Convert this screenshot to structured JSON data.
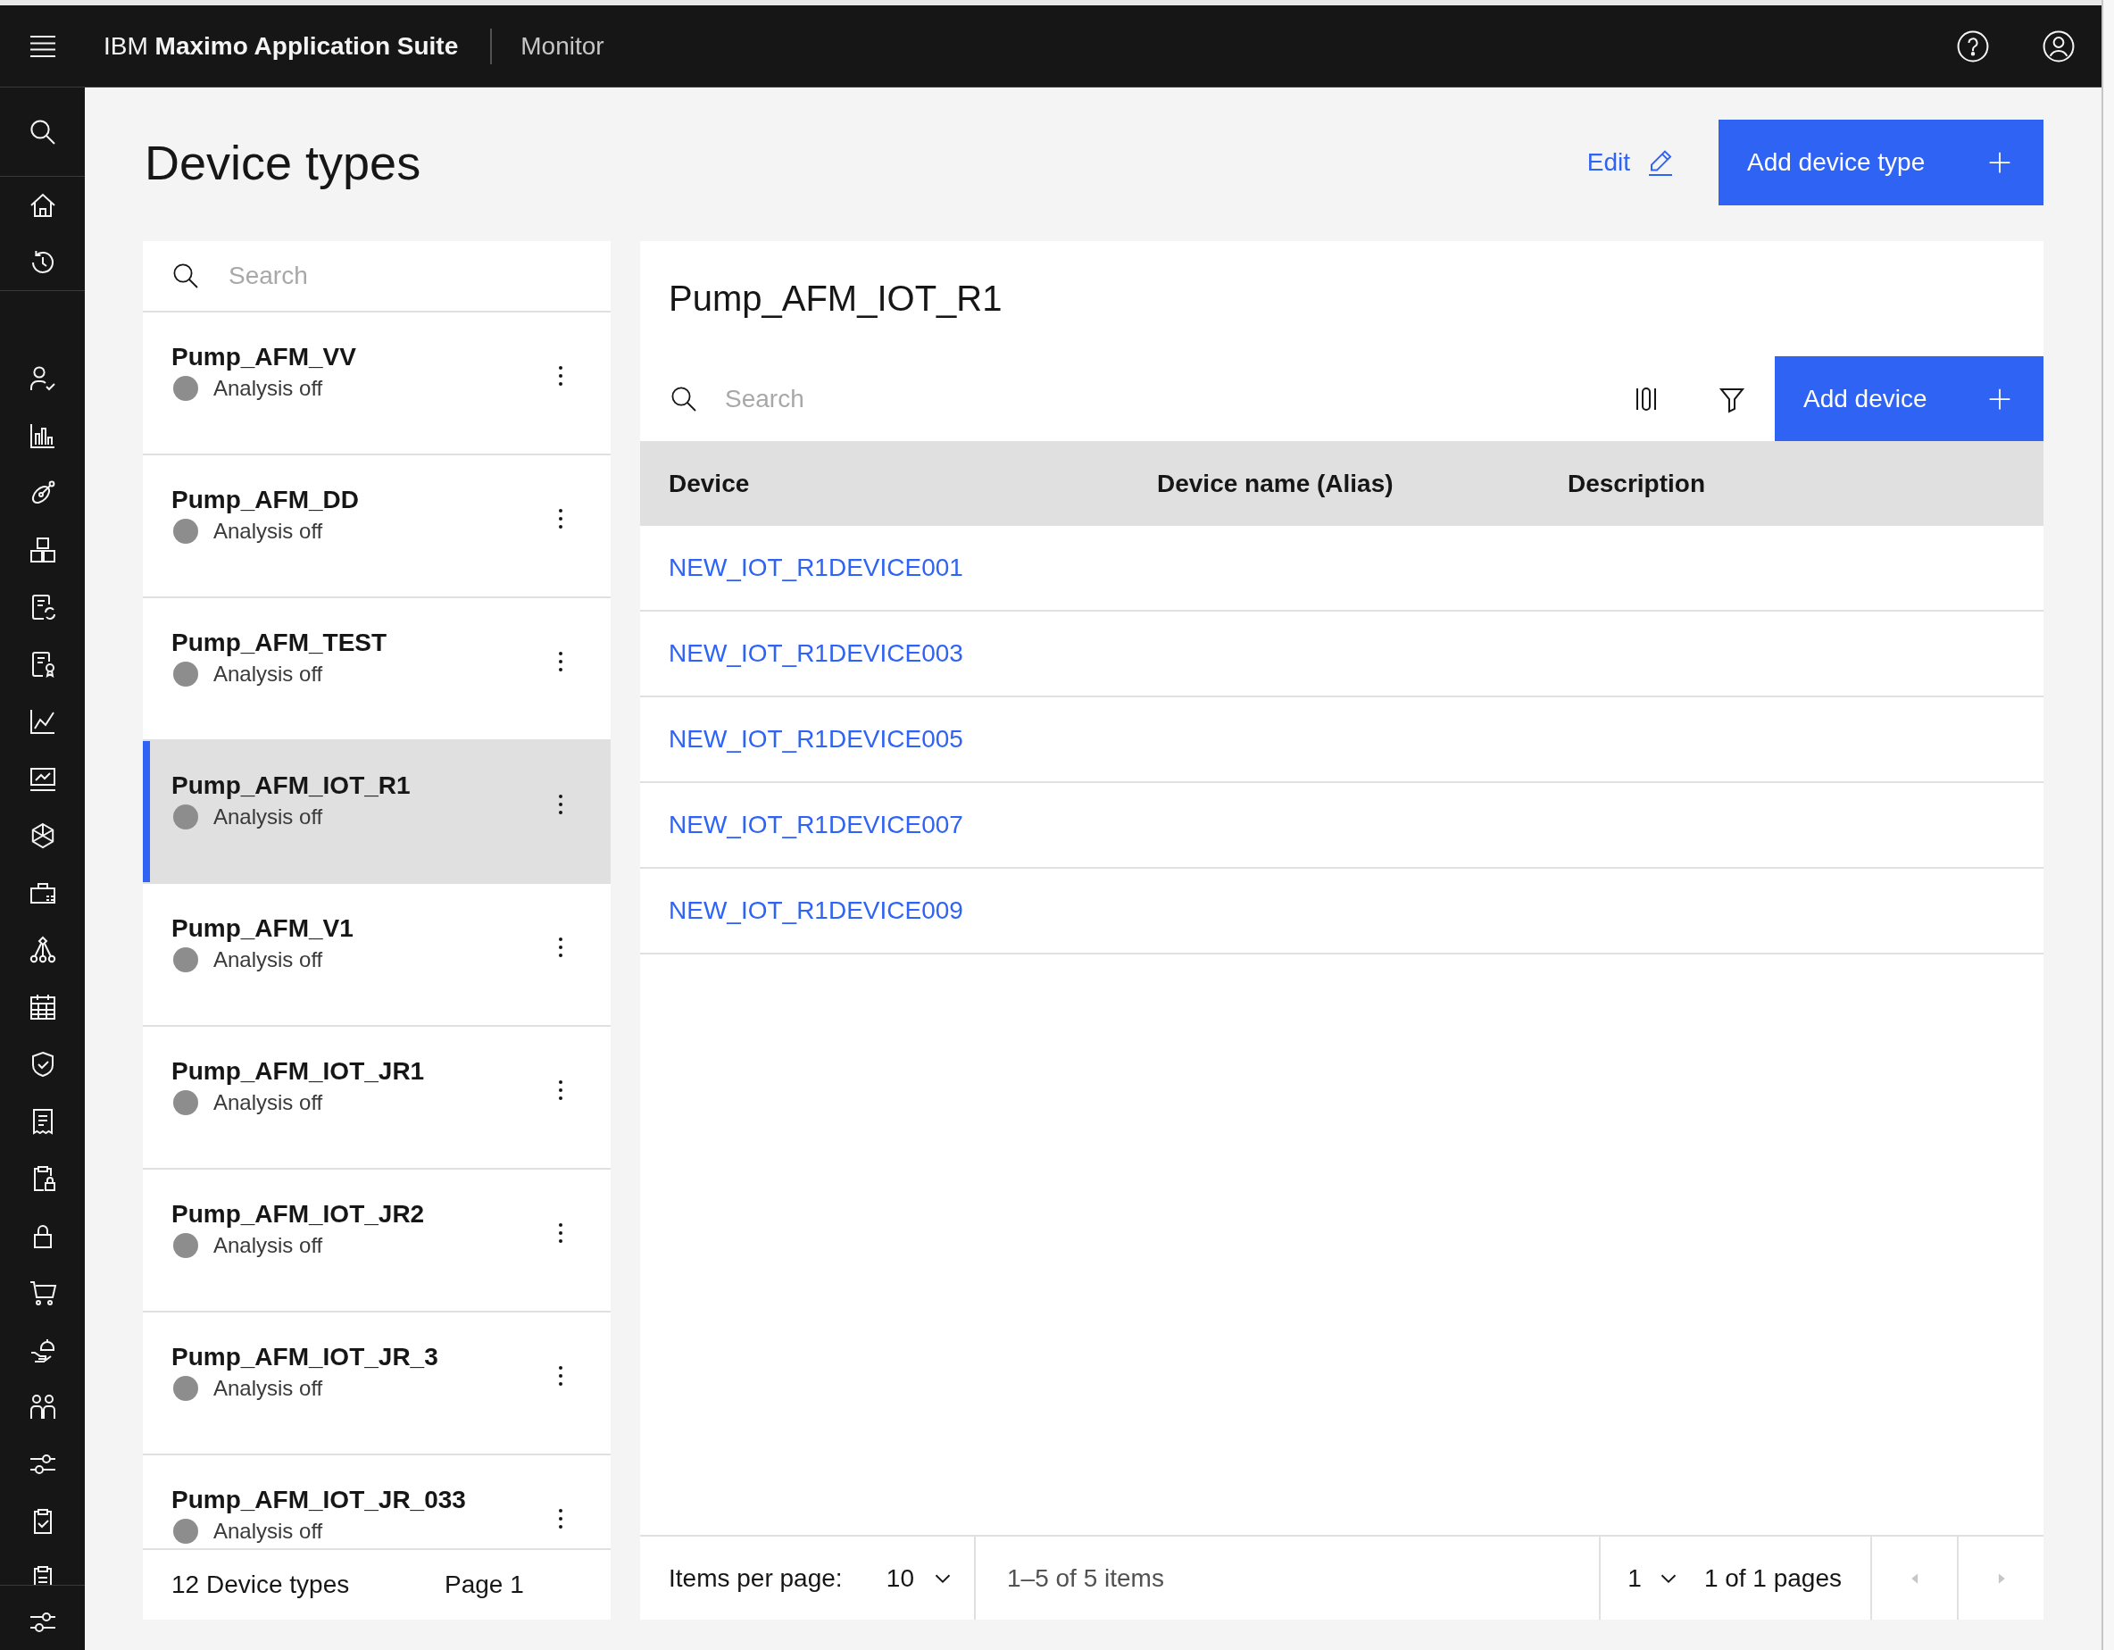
{
  "header": {
    "brand": "IBM **Maximo Application Suite**",
    "app_name": "Monitor"
  },
  "page": {
    "title": "Device types",
    "edit_link": "Edit",
    "add_button": "Add device type"
  },
  "device_types": {
    "search": {
      "placeholder": "Search"
    },
    "items": [
      {
        "name": "Pump_AFM_VV",
        "status": "Analysis off",
        "color": "#8d8d8d",
        "selected": false
      },
      {
        "name": "Pump_AFM_DD",
        "status": "Analysis off",
        "color": "#8d8d8d",
        "selected": false
      },
      {
        "name": "Pump_AFM_TEST",
        "status": "Analysis off",
        "color": "#8d8d8d",
        "selected": false
      },
      {
        "name": "Pump_AFM_IOT_R1",
        "status": "Analysis off",
        "color": "#8d8d8d",
        "selected": true
      },
      {
        "name": "Pump_AFM_V1",
        "status": "Analysis off",
        "color": "#8d8d8d",
        "selected": false
      },
      {
        "name": "Pump_AFM_IOT_JR1",
        "status": "Analysis off",
        "color": "#8d8d8d",
        "selected": false
      },
      {
        "name": "Pump_AFM_IOT_JR2",
        "status": "Analysis off",
        "color": "#8d8d8d",
        "selected": false
      },
      {
        "name": "Pump_AFM_IOT_JR_3",
        "status": "Analysis off",
        "color": "#8d8d8d",
        "selected": false
      },
      {
        "name": "Pump_AFM_IOT_JR_033",
        "status": "Analysis off",
        "color": "#8d8d8d",
        "selected": false
      }
    ],
    "footer": {
      "count": "12 Device types",
      "page": "Page 1"
    }
  },
  "details": {
    "title": "Pump_AFM_IOT_R1",
    "search": {
      "placeholder": "Search"
    },
    "add_button": "Add device",
    "table": {
      "columns": [
        "Device",
        "Device name (Alias)",
        "Description"
      ],
      "rows": [
        {
          "device": "NEW_IOT_R1DEVICE001"
        },
        {
          "device": "NEW_IOT_R1DEVICE003"
        },
        {
          "device": "NEW_IOT_R1DEVICE005"
        },
        {
          "device": "NEW_IOT_R1DEVICE007"
        },
        {
          "device": "NEW_IOT_R1DEVICE009"
        }
      ]
    },
    "pagination": {
      "items_per_page_label": "Items per page:",
      "page_size": "10",
      "range": "1–5 of 5 items",
      "page": "1",
      "page_count": "1 of 1 pages",
      "previous": {
        "disabled": true
      },
      "next": {
        "disabled": true
      }
    }
  }
}
